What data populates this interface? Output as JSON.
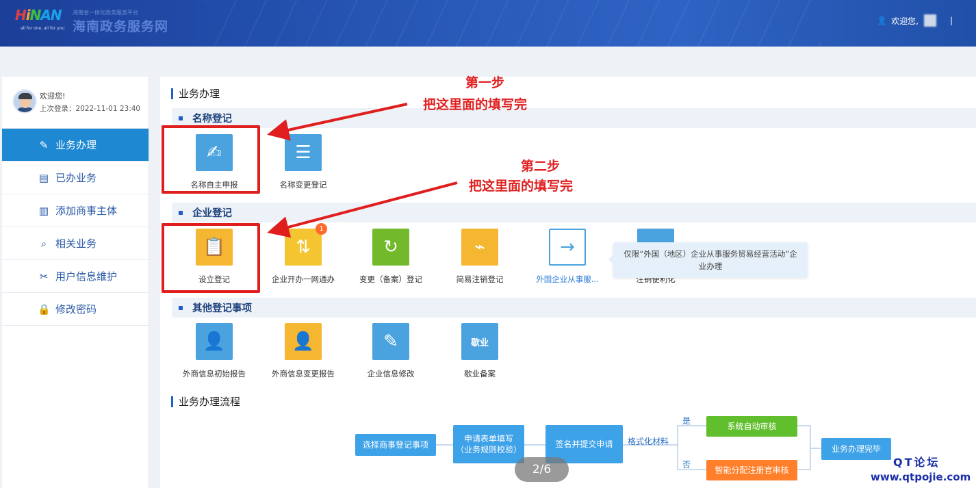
{
  "header": {
    "logo": "HiNAN",
    "logo_slogan": "all for one, all for you",
    "site_subtitle": "海南省一体化政务服务平台",
    "site_title": "海南政务服务网",
    "welcome": "欢迎您,",
    "separator": "|"
  },
  "profile": {
    "hello": "欢迎您!",
    "last_login": "上次登录：2022-11-01 23:40"
  },
  "sidebar": {
    "items": [
      {
        "label": "业务办理",
        "icon": "edit-doc-icon",
        "glyph": "✎"
      },
      {
        "label": "已办业务",
        "icon": "done-doc-icon",
        "glyph": "▤"
      },
      {
        "label": "添加商事主体",
        "icon": "building-icon",
        "glyph": "▥"
      },
      {
        "label": "相关业务",
        "icon": "search-doc-icon",
        "glyph": "⌕"
      },
      {
        "label": "用户信息维护",
        "icon": "tools-icon",
        "glyph": "✂"
      },
      {
        "label": "修改密码",
        "icon": "lock-icon",
        "glyph": "🔒"
      }
    ]
  },
  "main": {
    "title": "业务办理",
    "section1": {
      "title": "名称登记",
      "tiles": [
        {
          "label": "名称自主申报",
          "color": "#4aa3df",
          "glyph": "✍"
        },
        {
          "label": "名称变更登记",
          "color": "#4aa3df",
          "glyph": "☰"
        }
      ]
    },
    "section2": {
      "title": "企业登记",
      "tiles": [
        {
          "label": "设立登记",
          "color": "#f5b731",
          "glyph": "📋"
        },
        {
          "label": "企业开办一网通办",
          "color": "#f5c531",
          "glyph": "⇅",
          "badge": "1"
        },
        {
          "label": "变更（备案）登记",
          "color": "#72b92c",
          "glyph": "↻"
        },
        {
          "label": "简易注销登记",
          "color": "#f5b731",
          "glyph": "⌁"
        },
        {
          "label": "外国企业从事服...",
          "color": "#ffffff",
          "glyph": "→"
        },
        {
          "label": "注销便利化",
          "color": "#4aa3df",
          "glyph": "▭"
        }
      ],
      "tooltip": "仅限“外国（地区）企业从事服务贸易经营活动”企业办理"
    },
    "section3": {
      "title": "其他登记事项",
      "tiles": [
        {
          "label": "外商信息初始报告",
          "color": "#4aa3df",
          "glyph": "👤"
        },
        {
          "label": "外商信息变更报告",
          "color": "#f5b731",
          "glyph": "👤"
        },
        {
          "label": "企业信息修改",
          "color": "#4aa3df",
          "glyph": "✎"
        },
        {
          "label": "歇业备案",
          "color": "#4aa3df",
          "glyph": "歇业"
        }
      ]
    },
    "flow": {
      "title": "业务办理流程",
      "steps": [
        "选择商事登记事项",
        "申请表单填写\n（业务规则校验）",
        "签名并提交申请",
        "系统自动审核",
        "智能分配注册官审核",
        "业务办理完毕"
      ],
      "edge_label": "格式化材料",
      "yes": "是",
      "no": "否"
    }
  },
  "annotations": {
    "step1_title": "第一步",
    "step1_text": "把这里面的填写完",
    "step2_title": "第二步",
    "step2_text": "把这里面的填写完",
    "color": "#e01e1e"
  },
  "pager": "2/6",
  "watermark": {
    "line1": "QT论坛",
    "line2": "www.qtpojie.com"
  }
}
